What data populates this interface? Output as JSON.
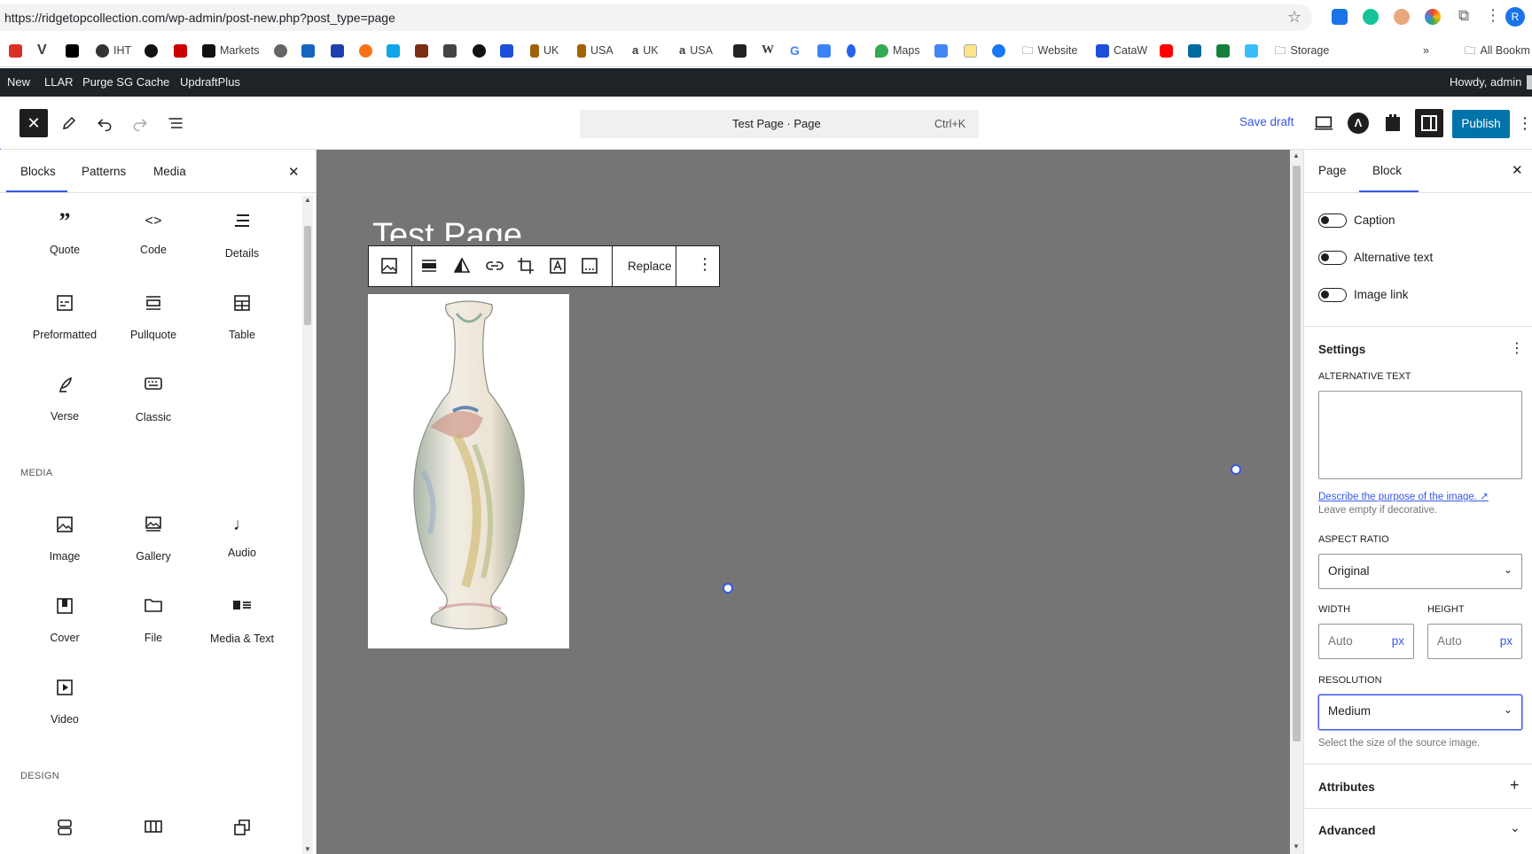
{
  "browser": {
    "url": "https://ridgetopcollection.com/wp-admin/post-new.php?post_type=page",
    "profile_initial": "R"
  },
  "bookmarks": {
    "items": [
      "IHT",
      "Markets",
      "UK",
      "USA",
      "UK",
      "USA",
      "Maps",
      "Website",
      "CataW",
      "Storage"
    ],
    "overflow": "»",
    "all_bookmarks": "All Bookm"
  },
  "adminbar": {
    "items": [
      "New",
      "LLAR",
      "Purge SG Cache",
      "UpdraftPlus"
    ],
    "howdy": "Howdy, admin"
  },
  "header": {
    "doc_title": "Test Page · Page",
    "shortcut": "Ctrl+K",
    "save_draft": "Save draft",
    "publish": "Publish"
  },
  "inserter": {
    "tabs": [
      "Blocks",
      "Patterns",
      "Media"
    ],
    "text_blocks": [
      {
        "label": "Quote",
        "icon": "quote-icon"
      },
      {
        "label": "Code",
        "icon": "code-icon"
      },
      {
        "label": "Details",
        "icon": "details-icon"
      },
      {
        "label": "Preformatted",
        "icon": "preformatted-icon"
      },
      {
        "label": "Pullquote",
        "icon": "pullquote-icon"
      },
      {
        "label": "Table",
        "icon": "table-icon"
      },
      {
        "label": "Verse",
        "icon": "verse-icon"
      },
      {
        "label": "Classic",
        "icon": "classic-icon"
      }
    ],
    "media_heading": "MEDIA",
    "media_blocks": [
      {
        "label": "Image",
        "icon": "image-icon"
      },
      {
        "label": "Gallery",
        "icon": "gallery-icon"
      },
      {
        "label": "Audio",
        "icon": "audio-icon"
      },
      {
        "label": "Cover",
        "icon": "cover-icon"
      },
      {
        "label": "File",
        "icon": "file-icon"
      },
      {
        "label": "Media & Text",
        "icon": "media-text-icon"
      },
      {
        "label": "Video",
        "icon": "video-icon"
      }
    ],
    "design_heading": "DESIGN"
  },
  "canvas": {
    "page_title": "Test Page",
    "toolbar_replace": "Replace"
  },
  "sidebar": {
    "tabs": [
      "Page",
      "Block"
    ],
    "active_tab": "Block",
    "toggles": [
      "Caption",
      "Alternative text",
      "Image link"
    ],
    "settings_title": "Settings",
    "alt_text_label": "ALTERNATIVE TEXT",
    "alt_text_value": "",
    "describe_link": "Describe the purpose of the image.",
    "describe_help": "Leave empty if decorative.",
    "aspect_ratio_label": "ASPECT RATIO",
    "aspect_ratio_value": "Original",
    "width_label": "WIDTH",
    "height_label": "HEIGHT",
    "width_placeholder": "Auto",
    "height_placeholder": "Auto",
    "unit": "px",
    "resolution_label": "RESOLUTION",
    "resolution_value": "Medium",
    "resolution_help": "Select the size of the source image.",
    "attributes": "Attributes",
    "advanced": "Advanced"
  },
  "colors": {
    "wp_blue": "#3858e9",
    "admin_bar": "#1d2327",
    "publish_bg": "#0073aa",
    "canvas_bg": "#757575"
  }
}
